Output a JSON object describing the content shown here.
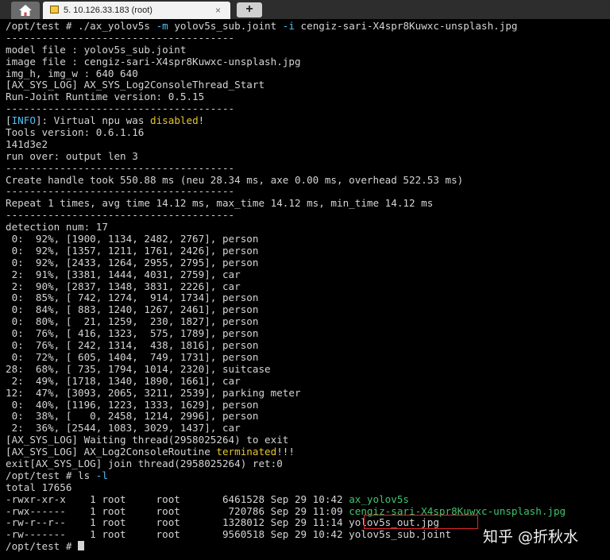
{
  "tab_bar": {
    "home_icon": "home-icon",
    "active_tab_title": "5. 10.126.33.183 (root)",
    "close_glyph": "×",
    "new_tab_glyph": "+"
  },
  "terminal": {
    "lines": [
      [
        {
          "t": "/opt/test # ./ax_yolov5s "
        },
        {
          "t": "-m",
          "c": "cyan"
        },
        {
          "t": " yolov5s_sub.joint "
        },
        {
          "t": "-i",
          "c": "cyan"
        },
        {
          "t": " cengiz-sari-X4spr8Kuwxc-unsplash.jpg"
        }
      ],
      [
        {
          "t": "--------------------------------------"
        }
      ],
      [
        {
          "t": "model file : yolov5s_sub.joint"
        }
      ],
      [
        {
          "t": "image file : cengiz-sari-X4spr8Kuwxc-unsplash.jpg"
        }
      ],
      [
        {
          "t": "img_h, img_w : 640 640"
        }
      ],
      [
        {
          "t": "[AX_SYS_LOG] AX_SYS_Log2ConsoleThread_Start"
        }
      ],
      [
        {
          "t": "Run-Joint Runtime version: 0.5.15"
        }
      ],
      [
        {
          "t": "--------------------------------------"
        }
      ],
      [
        {
          "t": "["
        },
        {
          "t": "INFO",
          "c": "cyan"
        },
        {
          "t": "]: Virtual npu was "
        },
        {
          "t": "disabled",
          "c": "yellow"
        },
        {
          "t": "!"
        }
      ],
      [
        {
          "t": "Tools version: 0.6.1.16"
        }
      ],
      [
        {
          "t": "141d3e2"
        }
      ],
      [
        {
          "t": "run over: output len 3"
        }
      ],
      [
        {
          "t": "--------------------------------------"
        }
      ],
      [
        {
          "t": "Create handle took 550.88 ms (neu 28.34 ms, axe 0.00 ms, overhead 522.53 ms)"
        }
      ],
      [
        {
          "t": "--------------------------------------"
        }
      ],
      [
        {
          "t": "Repeat 1 times, avg time 14.12 ms, max_time 14.12 ms, min_time 14.12 ms"
        }
      ],
      [
        {
          "t": "--------------------------------------"
        }
      ],
      [
        {
          "t": "detection num: 17"
        }
      ],
      [
        {
          "t": " 0:  92%, [1900, 1134, 2482, 2767], person"
        }
      ],
      [
        {
          "t": " 0:  92%, [1357, 1211, 1761, 2426], person"
        }
      ],
      [
        {
          "t": " 0:  92%, [2433, 1264, 2955, 2795], person"
        }
      ],
      [
        {
          "t": " 2:  91%, [3381, 1444, 4031, 2759], car"
        }
      ],
      [
        {
          "t": " 2:  90%, [2837, 1348, 3831, 2226], car"
        }
      ],
      [
        {
          "t": " 0:  85%, [ 742, 1274,  914, 1734], person"
        }
      ],
      [
        {
          "t": " 0:  84%, [ 883, 1240, 1267, 2461], person"
        }
      ],
      [
        {
          "t": " 0:  80%, [  21, 1259,  230, 1827], person"
        }
      ],
      [
        {
          "t": " 0:  76%, [ 416, 1323,  575, 1789], person"
        }
      ],
      [
        {
          "t": " 0:  76%, [ 242, 1314,  438, 1816], person"
        }
      ],
      [
        {
          "t": " 0:  72%, [ 605, 1404,  749, 1731], person"
        }
      ],
      [
        {
          "t": "28:  68%, [ 735, 1794, 1014, 2320], suitcase"
        }
      ],
      [
        {
          "t": " 2:  49%, [1718, 1340, 1890, 1661], car"
        }
      ],
      [
        {
          "t": "12:  47%, [3093, 2065, 3211, 2539], parking meter"
        }
      ],
      [
        {
          "t": " 0:  40%, [1196, 1223, 1333, 1629], person"
        }
      ],
      [
        {
          "t": " 0:  38%, [   0, 2458, 1214, 2996], person"
        }
      ],
      [
        {
          "t": " 2:  36%, [2544, 1083, 3029, 1437], car"
        }
      ],
      [
        {
          "t": "[AX_SYS_LOG] Waiting thread(2958025264) to exit"
        }
      ],
      [
        {
          "t": "[AX_SYS_LOG] AX_Log2ConsoleRoutine "
        },
        {
          "t": "terminated",
          "c": "yellow"
        },
        {
          "t": "!!!"
        }
      ],
      [
        {
          "t": "exit[AX_SYS_LOG] join thread(2958025264) ret:0"
        }
      ],
      [
        {
          "t": "/opt/test # ls "
        },
        {
          "t": "-l",
          "c": "cyan"
        }
      ],
      [
        {
          "t": "total 17656"
        }
      ],
      [
        {
          "t": "-rwxr-xr-x    1 root     root       6461528 Sep 29 10:42 "
        },
        {
          "t": "ax_yolov5s",
          "c": "green"
        }
      ],
      [
        {
          "t": "-rwx------    1 root     root        720786 Sep 29 11:09 "
        },
        {
          "t": "cengiz-sari-X4spr8Kuwxc-unsplash.jpg",
          "c": "green"
        }
      ],
      [
        {
          "t": "-rw-r--r--    1 root     root       1328012 Sep 29 11:14 yolov5s_out.jpg"
        }
      ],
      [
        {
          "t": "-rw-------    1 root     root       9560518 Sep 29 10:42 yolov5s_sub.joint"
        }
      ],
      [
        {
          "t": "/opt/test # "
        },
        {
          "cursor": true
        }
      ]
    ]
  },
  "colors": {
    "background": "#000000",
    "text": "#d4d4d4",
    "cyan": "#4fc3f7",
    "yellow": "#e8c32e",
    "green": "#3ec46d",
    "highlight_box": "#e0262a"
  },
  "watermark": "知乎 @折秋水"
}
